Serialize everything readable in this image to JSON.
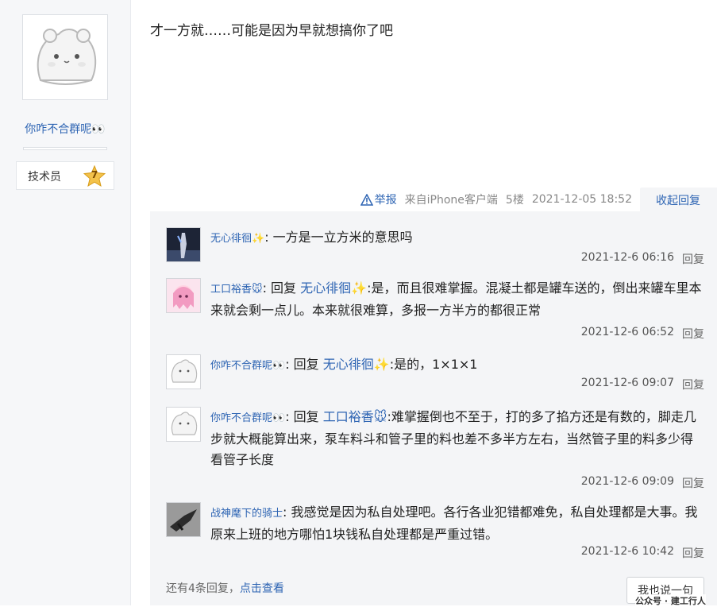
{
  "author": {
    "name": "你咋不合群呢👀",
    "rank_label": "技术员",
    "level": "7"
  },
  "post": {
    "content": "才一方就……可能是因为早就想搞你了吧",
    "report_label": "举报",
    "source": "来自iPhone客户端",
    "floor": "5楼",
    "time": "2021-12-05 18:52",
    "collapse_label": "收起回复"
  },
  "replies": [
    {
      "user": "无心徘徊✨",
      "colon": ":",
      "text": "一方是一立方米的意思吗",
      "time": "2021-12-6 06:16",
      "reply_label": "回复"
    },
    {
      "user": "工口裕香🐭",
      "colon": ":",
      "prefix": "回复",
      "target": "无心徘徊✨",
      "text": ":是，而且很难掌握。混凝土都是罐车送的，倒出来罐车里本来就会剩一点儿。本来就很难算，多报一方半方的都很正常",
      "time": "2021-12-6 06:52",
      "reply_label": "回复"
    },
    {
      "user": "你咋不合群呢👀",
      "colon": ":",
      "prefix": "回复",
      "target": "无心徘徊✨",
      "text": ":是的，1×1×1",
      "time": "2021-12-6 09:07",
      "reply_label": "回复"
    },
    {
      "user": "你咋不合群呢👀",
      "colon": ":",
      "prefix": "回复",
      "target": "工口裕香🐭",
      "text": ":难掌握倒也不至于，打的多了掐方还是有数的，脚走几步就大概能算出来，泵车料斗和管子里的料也差不多半方左右，当然管子里的料多少得看管子长度",
      "time": "2021-12-6 09:09",
      "reply_label": "回复"
    },
    {
      "user": "战神麾下的骑士",
      "colon": ":",
      "text": "我感觉是因为私自处理吧。各行各业犯错都难免，私自处理都是大事。我原来上班的地方哪怕1块钱私自处理都是严重过错。",
      "time": "2021-12-6 10:42",
      "reply_label": "回复"
    }
  ],
  "more": {
    "count_text": "还有4条回复，",
    "link": "点击查看"
  },
  "say_button": "我也说一句",
  "watermark": "公众号 · 建工行人"
}
